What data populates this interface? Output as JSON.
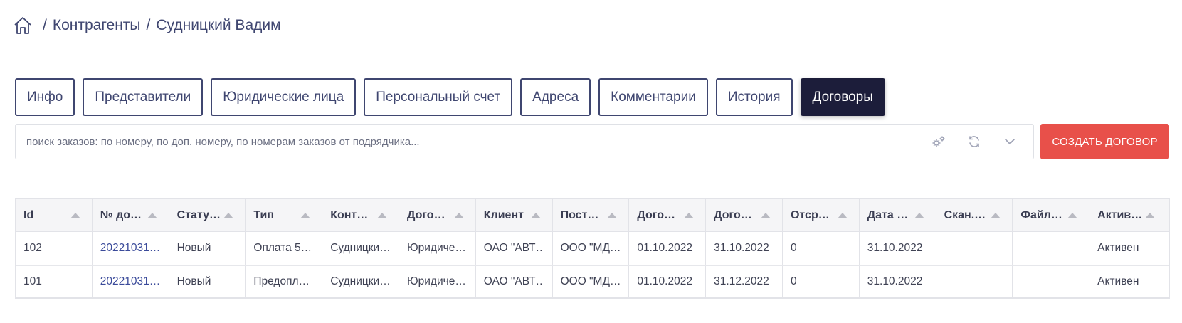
{
  "breadcrumb": {
    "home_icon": "home-icon",
    "items": [
      "Контрагенты",
      "Судницкий Вадим"
    ],
    "separator": "/"
  },
  "tabs": [
    {
      "label": "Инфо",
      "active": false
    },
    {
      "label": "Представители",
      "active": false
    },
    {
      "label": "Юридические лица",
      "active": false
    },
    {
      "label": "Персональный счет",
      "active": false
    },
    {
      "label": "Адреса",
      "active": false
    },
    {
      "label": "Комментарии",
      "active": false
    },
    {
      "label": "История",
      "active": false
    },
    {
      "label": "Договоры",
      "active": true
    }
  ],
  "search": {
    "placeholder": "поиск заказов: по номеру, по доп. номеру, по номерам заказов от подрядчика...",
    "icons": [
      "settings-icon",
      "refresh-icon",
      "chevron-down-icon"
    ]
  },
  "create_button": {
    "label": "СОЗДАТЬ ДОГОВОР"
  },
  "colors": {
    "accent": "#e8504a",
    "active_tab": "#1c1d3a",
    "text": "#3f4670",
    "link": "#3a4a9a"
  },
  "table": {
    "columns": [
      "Id",
      "№ до…",
      "Стату…",
      "Тип",
      "Конт…",
      "Дого…",
      "Клиент",
      "Пост…",
      "Дого…",
      "Дого…",
      "Отср…",
      "Дата …",
      "Скан.…",
      "Файл…",
      "Актив…"
    ],
    "rows": [
      [
        "102",
        "20221031…",
        "Новый",
        "Оплата 5…",
        "Судницки…",
        "Юридиче…",
        "ОАО \"АВТ…",
        "ООО \"МД…",
        "01.10.2022",
        "31.10.2022",
        "0",
        "31.10.2022",
        "",
        "",
        "Активен"
      ],
      [
        "101",
        "20221031…",
        "Новый",
        "Предопл…",
        "Судницки…",
        "Юридиче…",
        "ОАО \"АВТ…",
        "ООО \"МД…",
        "01.10.2022",
        "31.12.2022",
        "0",
        "31.10.2022",
        "",
        "",
        "Активен"
      ]
    ]
  }
}
